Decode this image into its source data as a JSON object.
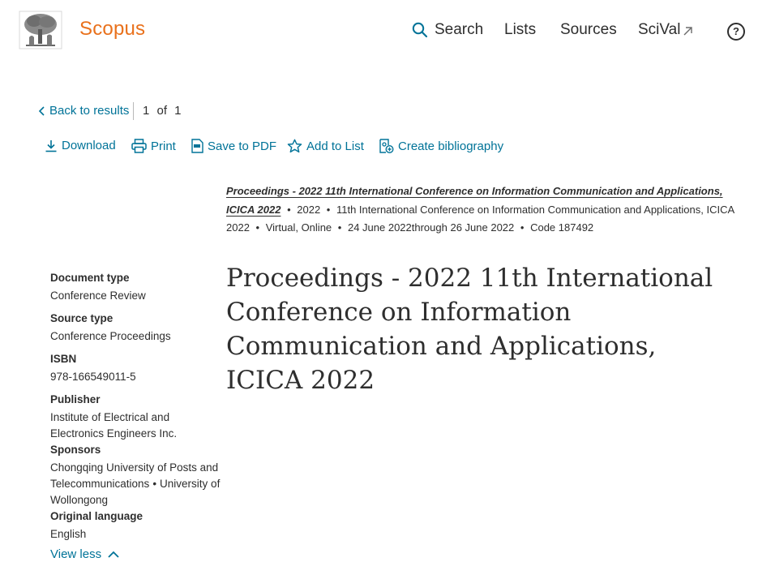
{
  "header": {
    "brand": "Scopus",
    "nav": {
      "search": "Search",
      "lists": "Lists",
      "sources": "Sources",
      "scival": "SciVal"
    },
    "help": "?"
  },
  "result_nav": {
    "back": "Back to results",
    "pager": "1 of 1"
  },
  "toolbar": {
    "download": "Download",
    "print": "Print",
    "save_pdf": "Save to PDF",
    "add_list": "Add to List",
    "bibliography": "Create bibliography"
  },
  "source": {
    "title": "Proceedings - 2022 11th International Conference on Information Communication and Applications, ICICA 2022",
    "year": "2022",
    "conference": "11th International Conference on Information Communication and Applications, ICICA 2022",
    "location": "Virtual, Online",
    "dates": "24 June 2022through 26 June 2022",
    "code": "Code 187492",
    "separator": "•"
  },
  "document": {
    "title": "Proceedings - 2022 11th International Conference on Information Communication and Applications, ICICA 2022"
  },
  "details": {
    "doc_type_label": "Document type",
    "doc_type": "Conference Review",
    "source_type_label": "Source type",
    "source_type": "Conference Proceedings",
    "isbn_label": "ISBN",
    "isbn": "978-166549011-5",
    "publisher_label": "Publisher",
    "publisher": "Institute of Electrical and Electronics Engineers Inc.",
    "sponsors_label": "Sponsors",
    "sponsor_1": "Chongqing University of Posts and Telecommunications",
    "sponsor_2": "University of Wollongong",
    "language_label": "Original language",
    "language": "English",
    "view_less": "View less"
  },
  "colors": {
    "brand": "#e9711c",
    "link": "#007398",
    "text": "#2e2e2e"
  }
}
